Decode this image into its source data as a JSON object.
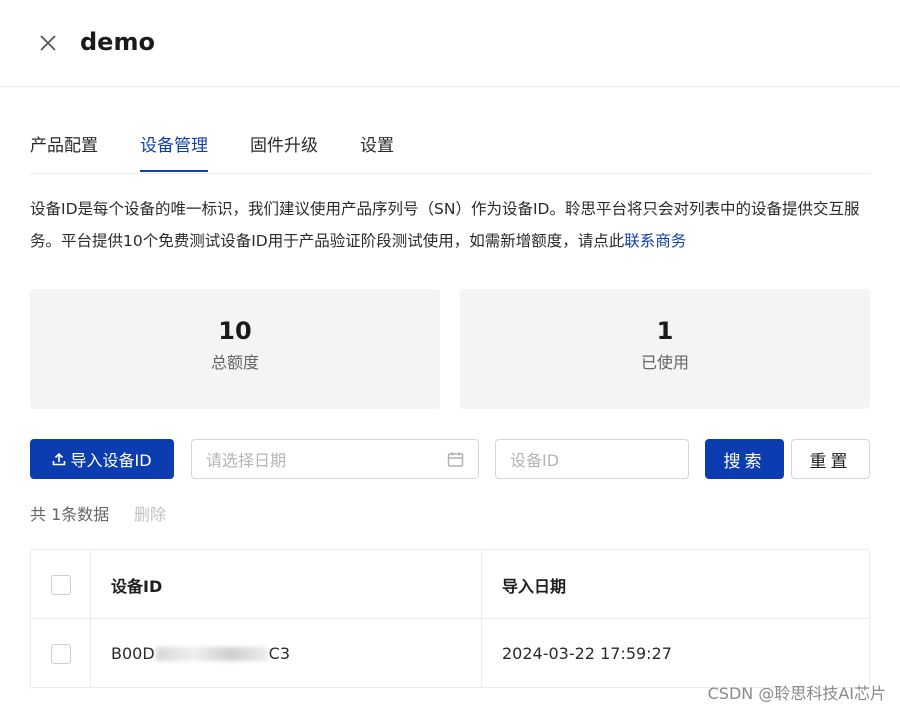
{
  "header": {
    "title": "demo"
  },
  "tabs": [
    {
      "label": "产品配置"
    },
    {
      "label": "设备管理"
    },
    {
      "label": "固件升级"
    },
    {
      "label": "设置"
    }
  ],
  "active_tab": "设备管理",
  "description": {
    "text": "设备ID是每个设备的唯一标识，我们建议使用产品序列号（SN）作为设备ID。聆思平台将只会对列表中的设备提供交互服务。平台提供10个免费测试设备ID用于产品验证阶段测试使用，如需新增额度，请点此",
    "link": "联系商务"
  },
  "stats": {
    "total": {
      "value": "10",
      "label": "总额度"
    },
    "used": {
      "value": "1",
      "label": "已使用"
    }
  },
  "toolbar": {
    "import_label": "导入设备ID",
    "date_placeholder": "请选择日期",
    "device_id_placeholder": "设备ID",
    "search_label": "搜索",
    "reset_label": "重置"
  },
  "list": {
    "count_text": "共 1条数据",
    "delete_label": "删除"
  },
  "table": {
    "columns": [
      "设备ID",
      "导入日期"
    ],
    "rows": [
      {
        "device_id_prefix": "B00D",
        "device_id_suffix": "C3",
        "import_date": "2024-03-22 17:59:27"
      }
    ]
  },
  "watermark": "CSDN @聆思科技AI芯片",
  "colors": {
    "primary": "#0b3db1",
    "tab_active": "#0f3fa8",
    "card_bg": "#f4f4f4"
  }
}
